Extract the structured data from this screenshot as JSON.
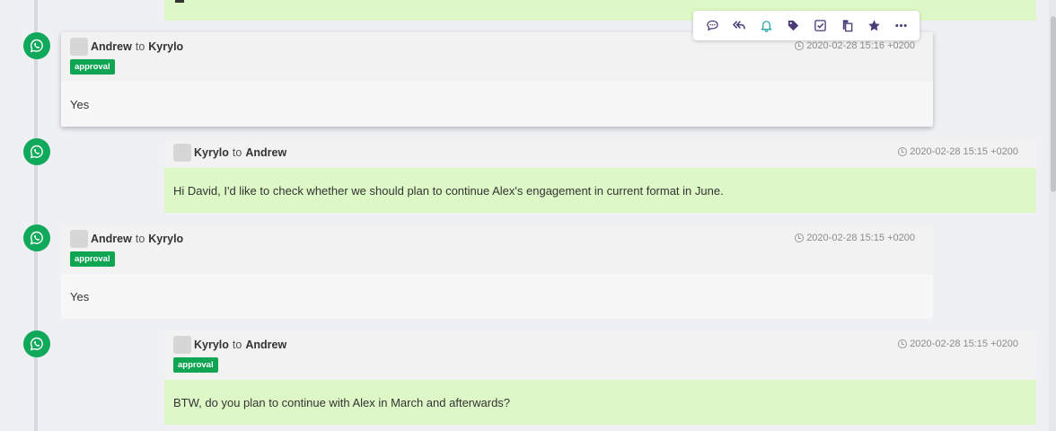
{
  "toolbar": {
    "actions": [
      {
        "icon": "comment-icon",
        "label": "Comment"
      },
      {
        "icon": "reply-all-icon",
        "label": "Reply all"
      },
      {
        "icon": "bell-icon",
        "label": "Reminder"
      },
      {
        "icon": "tag-icon",
        "label": "Tag"
      },
      {
        "icon": "checkbox-icon",
        "label": "Task"
      },
      {
        "icon": "copy-icon",
        "label": "Copy"
      },
      {
        "icon": "star-icon",
        "label": "Star"
      },
      {
        "icon": "more-icon",
        "label": "More"
      }
    ]
  },
  "messages": [
    {
      "direction": "in",
      "from": "Andrew",
      "to_word": "to",
      "recipient": "Kyrylo",
      "timestamp": "2020-02-28 15:16 +0200",
      "tag": "approval",
      "body": "Yes"
    },
    {
      "direction": "out",
      "from": "Kyrylo",
      "to_word": "to",
      "recipient": "Andrew",
      "timestamp": "2020-02-28 15:15 +0200",
      "tag": "",
      "body": "Hi David, I'd like to check whether we should plan to continue Alex's engagement in current format in June."
    },
    {
      "direction": "in",
      "from": "Andrew",
      "to_word": "to",
      "recipient": "Kyrylo",
      "timestamp": "2020-02-28 15:15 +0200",
      "tag": "approval",
      "body": "Yes"
    },
    {
      "direction": "out",
      "from": "Kyrylo",
      "to_word": "to",
      "recipient": "Andrew",
      "timestamp": "2020-02-28 15:15 +0200",
      "tag": "approval",
      "body": "BTW, do you plan to continue with Alex in March and afterwards?"
    }
  ],
  "colors": {
    "whatsapp_green": "#10a85a",
    "tag_green": "#0fa552",
    "outgoing_bg": "#ddf8c6",
    "incoming_bg": "#f7f7f7",
    "toolbar_icon_purple": "#4a3a78",
    "toolbar_icon_teal": "#1aa0a0"
  }
}
